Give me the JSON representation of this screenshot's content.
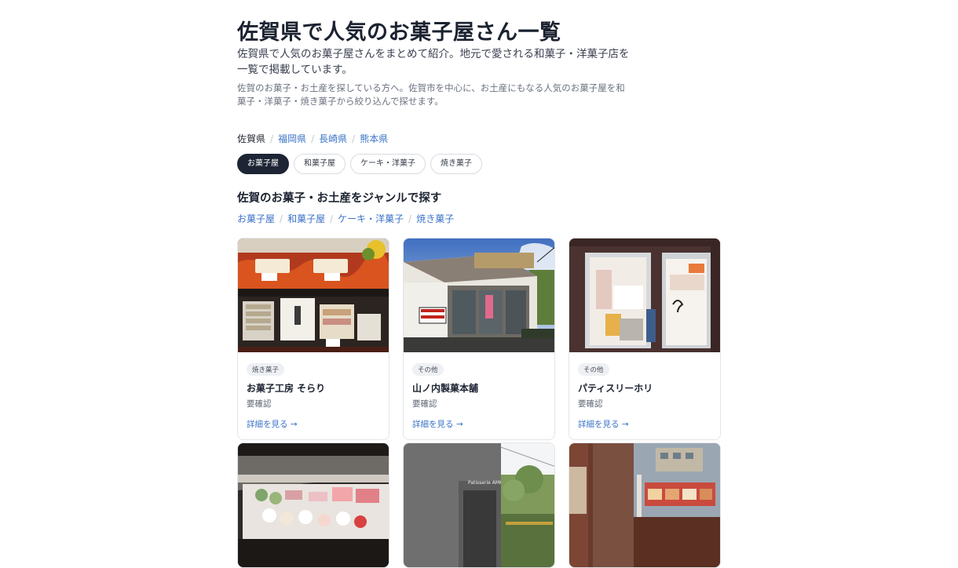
{
  "page": {
    "title": "佐賀県で人気のお菓子屋さん一覧",
    "lead": "佐賀県で人気のお菓子屋さんをまとめて紹介。地元で愛される和菓子・洋菓子店を一覧で掲載しています。",
    "sub": "佐賀のお菓子・お土産を探している方へ。佐賀市を中心に、お土産にもなる人気のお菓子屋を和菓子・洋菓子・焼き菓子から絞り込んで探せます。"
  },
  "prefectures": {
    "current": "佐賀県",
    "links": [
      "福岡県",
      "長崎県",
      "熊本県"
    ]
  },
  "chips": [
    "お菓子屋",
    "和菓子屋",
    "ケーキ・洋菓子",
    "焼き菓子"
  ],
  "genre_section": {
    "heading": "佐賀のお菓子・お土産をジャンルで探す",
    "links": [
      "お菓子屋",
      "和菓子屋",
      "ケーキ・洋菓子",
      "焼き菓子"
    ]
  },
  "shops": [
    {
      "tag": "焼き菓子",
      "name": "お菓子工房 そらり",
      "status": "要確認",
      "more": "詳細を見る →"
    },
    {
      "tag": "その他",
      "name": "山ノ内製菓本舗",
      "status": "要確認",
      "more": "詳細を見る →"
    },
    {
      "tag": "その他",
      "name": "パティスリーホリ",
      "status": "要確認",
      "more": "詳細を見る →"
    }
  ],
  "store_sign": "Patisserie AMK"
}
